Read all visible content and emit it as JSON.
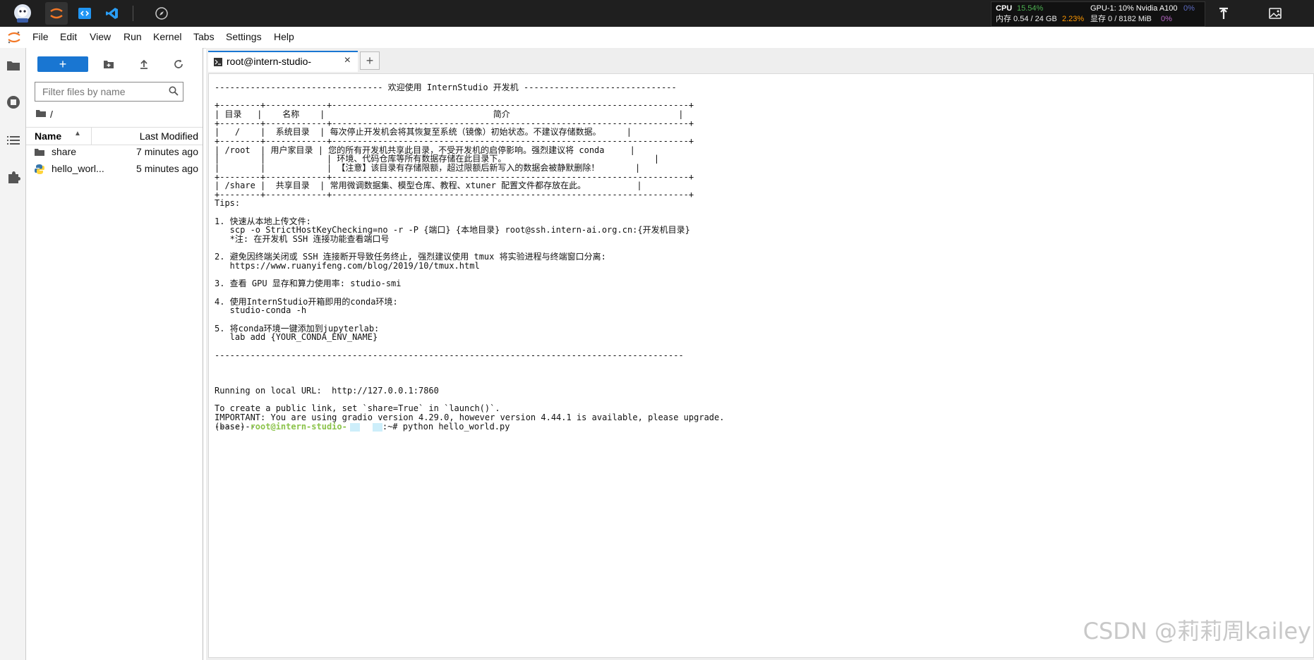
{
  "topbar": {
    "stats": {
      "cpu_label": "CPU",
      "cpu_value": "15.54%",
      "mem_text": "内存 0.54 / 24 GB",
      "mem_pct": "2.23%",
      "gpu_label": "GPU-1: 10% Nvidia A100",
      "gpu_pct": "0%",
      "vram_text": "显存 0 / 8182 MiB",
      "vram_pct": "0%"
    }
  },
  "menu": [
    "File",
    "Edit",
    "View",
    "Run",
    "Kernel",
    "Tabs",
    "Settings",
    "Help"
  ],
  "filebrowser": {
    "new_label": "+",
    "search_placeholder": "Filter files by name",
    "breadcrumb": "/",
    "col_name": "Name",
    "col_modified": "Last Modified",
    "rows": [
      {
        "name": "share",
        "modified": "7 minutes ago",
        "icon": "folder-icon"
      },
      {
        "name": "hello_worl...",
        "modified": "5 minutes ago",
        "icon": "python-file-icon"
      }
    ]
  },
  "tab": {
    "title": "root@intern-studio-",
    "close": "×",
    "add": "+"
  },
  "terminal": {
    "lines": [
      "--------------------------------- 欢迎使用 InternStudio 开发机 ------------------------------",
      "",
      "+--------+------------+----------------------------------------------------------------------+",
      "| 目录   |    名称    |                                 简介                                 |",
      "+--------+------------+----------------------------------------------------------------------+",
      "|   /    |  系统目录  | 每次停止开发机会将其恢复至系统（镜像）初始状态。不建议存储数据。     |",
      "+--------+------------+----------------------------------------------------------------------+",
      "| /root  | 用户家目录 | 您的所有开发机共享此目录，不受开发机的启停影响。强烈建议将 conda     |",
      "|        |            | 环境、代码仓库等所有数据存储在此目录下。                             |",
      "|        |            | 【注意】该目录有存储限额，超过限额后新写入的数据会被静默删除！       |",
      "+--------+------------+----------------------------------------------------------------------+",
      "| /share |  共享目录  | 常用微调数据集、模型仓库、教程、xtuner 配置文件都存放在此。          |",
      "+--------+------------+----------------------------------------------------------------------+",
      "Tips:",
      "",
      "1. 快速从本地上传文件:",
      "   scp -o StrictHostKeyChecking=no -r -P {端口} {本地目录} root@ssh.intern-ai.org.cn:{开发机目录}",
      "   *注: 在开发机 SSH 连接功能查看端口号",
      "",
      "2. 避免因终端关闭或 SSH 连接断开导致任务终止, 强烈建议使用 tmux 将实验进程与终端窗口分离:",
      "   https://www.ruanyifeng.com/blog/2019/10/tmux.html",
      "",
      "3. 查看 GPU 显存和算力使用率: studio-smi",
      "",
      "4. 使用InternStudio开箱即用的conda环境:",
      "   studio-conda -h",
      "",
      "5. 将conda环境一键添加到jupyterlab:",
      "   lab add {YOUR_CONDA_ENV_NAME}",
      "",
      "--------------------------------------------------------------------------------------------",
      "",
      "",
      "Running on local URL:  http://127.0.0.1:7860",
      "",
      "To create a public link, set `share=True` in `launch()`.",
      "IMPORTANT: You are using gradio version 4.29.0, however version 4.44.1 is available, please upgrade.",
      "--------"
    ],
    "prompt": {
      "prefix": "(base) ",
      "host": "root@intern-studio-",
      "suffix": ":~# python hello_world.py"
    }
  },
  "watermark": "CSDN @莉莉周kailey",
  "colors": {
    "accent": "#1976d2",
    "prompt_host": "#8bc34a",
    "cpu": "#4caf50",
    "mem": "#ff9800",
    "gpu": "#5c6bc0",
    "vram": "#ba68c8"
  }
}
